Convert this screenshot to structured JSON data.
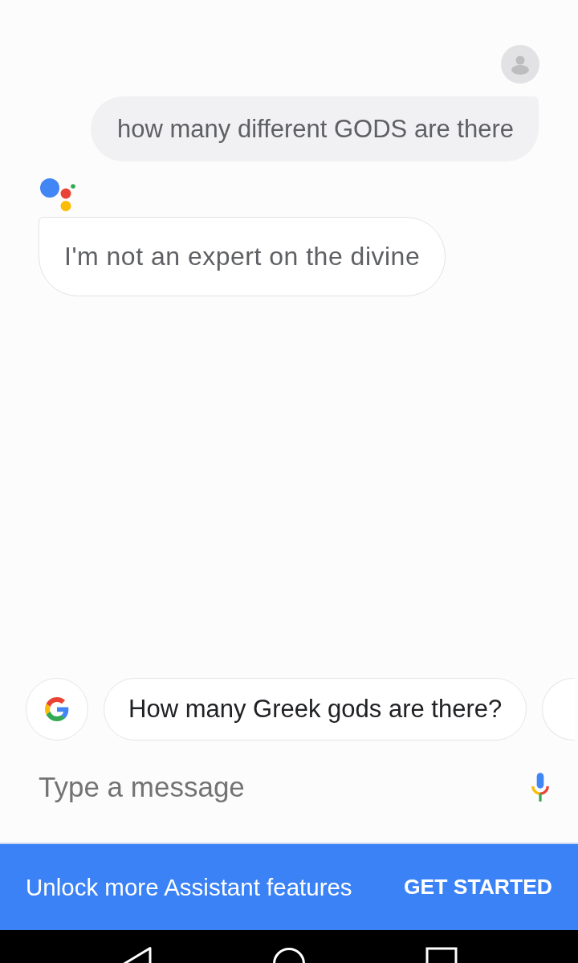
{
  "conversation": [
    {
      "kind": "user",
      "text": "how many different GODS are there"
    },
    {
      "kind": "assistant",
      "text": "I'm not an expert on the divine"
    }
  ],
  "suggestions": {
    "chips": [
      {
        "label": "How many Greek gods are there?"
      }
    ],
    "next_chip_peek": true
  },
  "composer": {
    "placeholder": "Type a message"
  },
  "banner": {
    "text": "Unlock more Assistant features",
    "button": "GET STARTED"
  },
  "nav_bar": {
    "buttons": [
      {
        "kind": "back"
      },
      {
        "kind": "home"
      },
      {
        "kind": "recents"
      }
    ]
  }
}
